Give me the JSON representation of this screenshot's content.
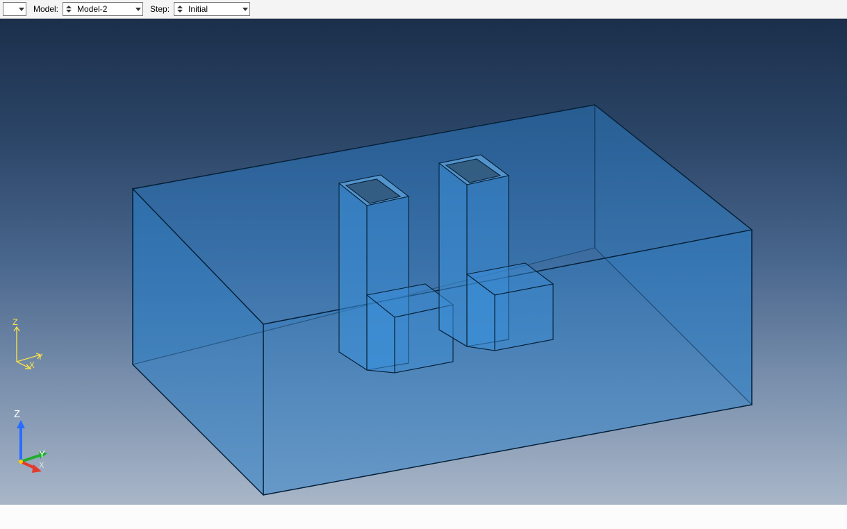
{
  "toolbar": {
    "model_label": "Model:",
    "model_value": "Model-2",
    "step_label": "Step:",
    "step_value": "Initial"
  },
  "triad": {
    "z": "Z",
    "y": "Y",
    "x": "X"
  },
  "geometry_color": "#2a7fc9"
}
